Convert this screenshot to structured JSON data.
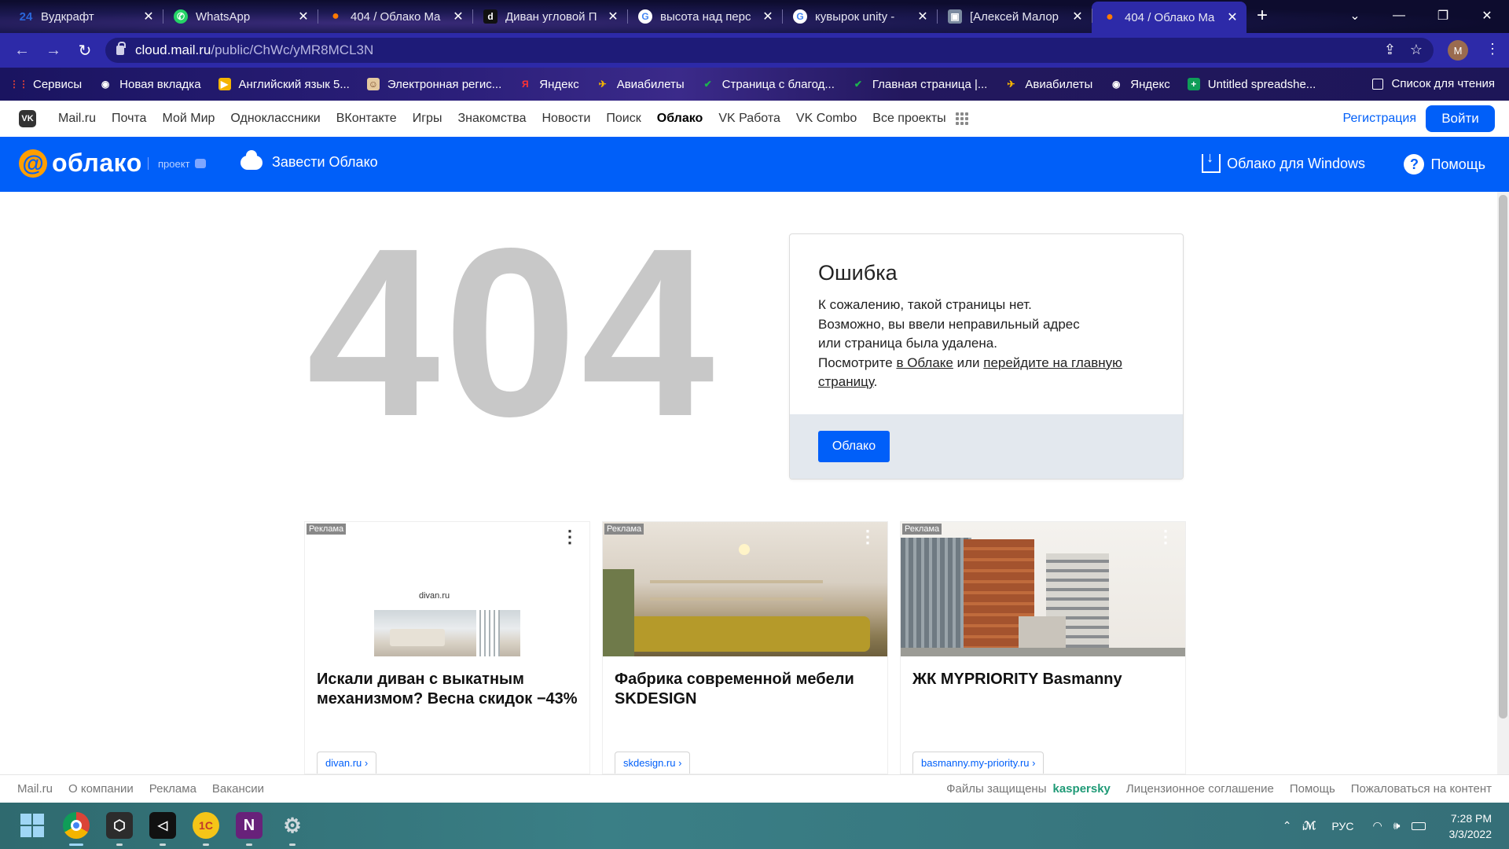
{
  "browser": {
    "tabs": [
      {
        "title": "Вудкрафт",
        "icon_text": "24",
        "icon_color": "#2a66d9",
        "active": false
      },
      {
        "title": "WhatsApp",
        "icon_text": "✆",
        "icon_color": "#25d366",
        "active": false
      },
      {
        "title": "404 / Облако Ma",
        "icon_text": "●",
        "icon_color": "#ff7a00",
        "active": false
      },
      {
        "title": "Диван угловой П",
        "icon_text": "d",
        "icon_color": "#111111",
        "active": false
      },
      {
        "title": "высота над перс",
        "icon_text": "G",
        "icon_color": "#4285f4",
        "active": false
      },
      {
        "title": "кувырок unity - ",
        "icon_text": "G",
        "icon_color": "#4285f4",
        "active": false
      },
      {
        "title": "[Алексей Малор",
        "icon_text": "▣",
        "icon_color": "#7b8aa0",
        "active": false
      },
      {
        "title": "404 / Облако Ma",
        "icon_text": "●",
        "icon_color": "#ff7a00",
        "active": true
      }
    ],
    "url_host": "cloud.mail.ru",
    "url_path": "/public/ChWc/yMR8MCL3N",
    "profile_initial": "M",
    "bookmarks": [
      {
        "label": "Сервисы",
        "icon_text": "⋮⋮",
        "icon_color": "#e94335"
      },
      {
        "label": "Новая вкладка",
        "icon_text": "◉",
        "icon_color": "#ffffff"
      },
      {
        "label": "Английский язык 5...",
        "icon_text": "▶",
        "icon_color": "#f5b400"
      },
      {
        "label": "Электронная регис...",
        "icon_text": "☺",
        "icon_color": "#e4c9a0"
      },
      {
        "label": "Яндекс",
        "icon_text": "Я",
        "icon_color": "#ff3333"
      },
      {
        "label": "Авиабилеты",
        "icon_text": "✈",
        "icon_color": "#f5b400"
      },
      {
        "label": "Страница с благод...",
        "icon_text": "✔",
        "icon_color": "#1cb34f"
      },
      {
        "label": "Главная страница |...",
        "icon_text": "✔",
        "icon_color": "#1cb34f"
      },
      {
        "label": "Авиабилеты",
        "icon_text": "✈",
        "icon_color": "#f5b400"
      },
      {
        "label": "Яндекс",
        "icon_text": "◉",
        "icon_color": "#ffffff"
      },
      {
        "label": "Untitled spreadshe...",
        "icon_text": "+",
        "icon_color": "#0f9d58"
      }
    ],
    "reading_list": "Список для чтения"
  },
  "topnav": {
    "links": [
      "Mail.ru",
      "Почта",
      "Мой Мир",
      "Одноклассники",
      "ВКонтакте",
      "Игры",
      "Знакомства",
      "Новости",
      "Поиск",
      "Облако",
      "VK Работа",
      "VK Combo",
      "Все проекты"
    ],
    "active_link": "Облако",
    "register": "Регистрация",
    "login": "Войти"
  },
  "cloudbar": {
    "logo": "облако",
    "project": "проект",
    "get_cloud": "Завести Облако",
    "windows": "Облако для Windows",
    "help": "Помощь"
  },
  "error": {
    "code": "404",
    "title": "Ошибка",
    "line1": "К сожалению, такой страницы нет.",
    "line2": "Возможно, вы ввели неправильный адрес",
    "line3": "или страница была удалена.",
    "line4_prefix": "Посмотрите ",
    "link_cloud": "в Облаке",
    "line4_mid": " или ",
    "link_main": "перейдите на главную страницу",
    "line4_suffix": ".",
    "button": "Облако"
  },
  "ads": [
    {
      "label": "Реклама",
      "title": "Искали диван с выкатным механизмом? Весна скидок −43%",
      "domain": "divan.ru ›",
      "brand": "divan.ru"
    },
    {
      "label": "Реклама",
      "title": "Фабрика современной мебели SKDESIGN",
      "domain": "skdesign.ru ›"
    },
    {
      "label": "Реклама",
      "title": "ЖК MYPRIORITY Basmanny",
      "domain": "basmanny.my-priority.ru ›"
    }
  ],
  "footer": {
    "left": [
      "Mail.ru",
      "О компании",
      "Реклама",
      "Вакансии"
    ],
    "protected": "Файлы защищены",
    "kaspersky": "kaspersky",
    "right": [
      "Лицензионное соглашение",
      "Помощь",
      "Пожаловаться на контент"
    ]
  },
  "taskbar": {
    "lang": "РУС",
    "time": "7:28 PM",
    "date": "3/3/2022"
  },
  "colors": {
    "accent": "#005ff9",
    "orange": "#ff9e00",
    "gray404": "#c8c8c8"
  }
}
